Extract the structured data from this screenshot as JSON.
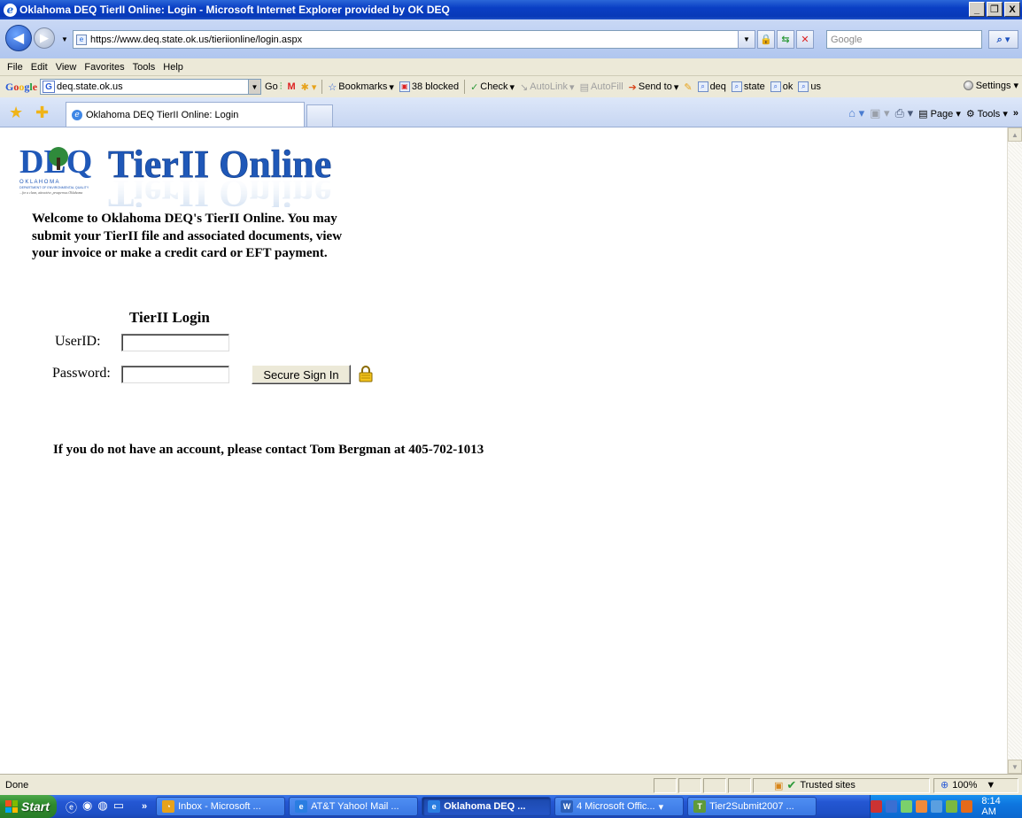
{
  "window": {
    "title": "Oklahoma DEQ TierII Online: Login - Microsoft Internet Explorer provided by OK DEQ",
    "controls": {
      "minimize": "_",
      "restore": "❐",
      "close": "X"
    }
  },
  "address_bar": {
    "url": "https://www.deq.state.ok.us/tieriionline/login.aspx",
    "search_placeholder": "Google"
  },
  "menu": [
    "File",
    "Edit",
    "View",
    "Favorites",
    "Tools",
    "Help"
  ],
  "google_toolbar": {
    "logo": "Google",
    "search_value": "deq.state.ok.us",
    "go": "Go",
    "bookmarks": "Bookmarks",
    "blocked": "38 blocked",
    "check": "Check",
    "autolink": "AutoLink",
    "autofill": "AutoFill",
    "send_to": "Send to",
    "highlights": [
      "deq",
      "state",
      "ok",
      "us"
    ],
    "settings": "Settings"
  },
  "tabs": {
    "active_tab": "Oklahoma DEQ TierII Online: Login",
    "page_menu": "Page",
    "tools_menu": "Tools"
  },
  "page": {
    "logo_org": "DEQ",
    "logo_state": "O K L A H O M A",
    "logo_dept": "DEPARTMENT OF ENVIRONMENTAL QUALITY",
    "logo_tagline": "...for a clean, attractive, prosperous Oklahoma",
    "logo_title": "TierII Online",
    "welcome": "Welcome to Oklahoma DEQ's TierII Online. You may submit your TierII file and associated documents, view your invoice or make a credit card or EFT payment.",
    "login_title": "TierII Login",
    "userid_label": "UserID:",
    "userid_value": "",
    "password_label": "Password:",
    "password_value": "",
    "signin_button": "Secure Sign In",
    "contact_text": "If you do not have an account, please contact Tom Bergman at 405-702-1013"
  },
  "status_bar": {
    "status": "Done",
    "zone": "Trusted sites",
    "zoom": "100%"
  },
  "taskbar": {
    "start": "Start",
    "chevron": "»",
    "tasks": [
      {
        "label": "Inbox - Microsoft ...",
        "icon_color": "#e7a21a",
        "active": false
      },
      {
        "label": "AT&T Yahoo! Mail ...",
        "icon_color": "#2a7de1",
        "active": false
      },
      {
        "label": "Oklahoma DEQ ...",
        "icon_color": "#2a7de1",
        "active": true
      },
      {
        "label": "4 Microsoft Offic...",
        "icon_color": "#2b5eb8",
        "active": false
      },
      {
        "label": "Tier2Submit2007 ...",
        "icon_color": "#5f9a3a",
        "active": false
      }
    ],
    "clock": "8:14 AM"
  },
  "colors": {
    "titlebar": "#0a3fc4",
    "chrome": "#ece9d8",
    "logo_blue": "#1f58b8",
    "logo_green": "#2f8a3b"
  }
}
